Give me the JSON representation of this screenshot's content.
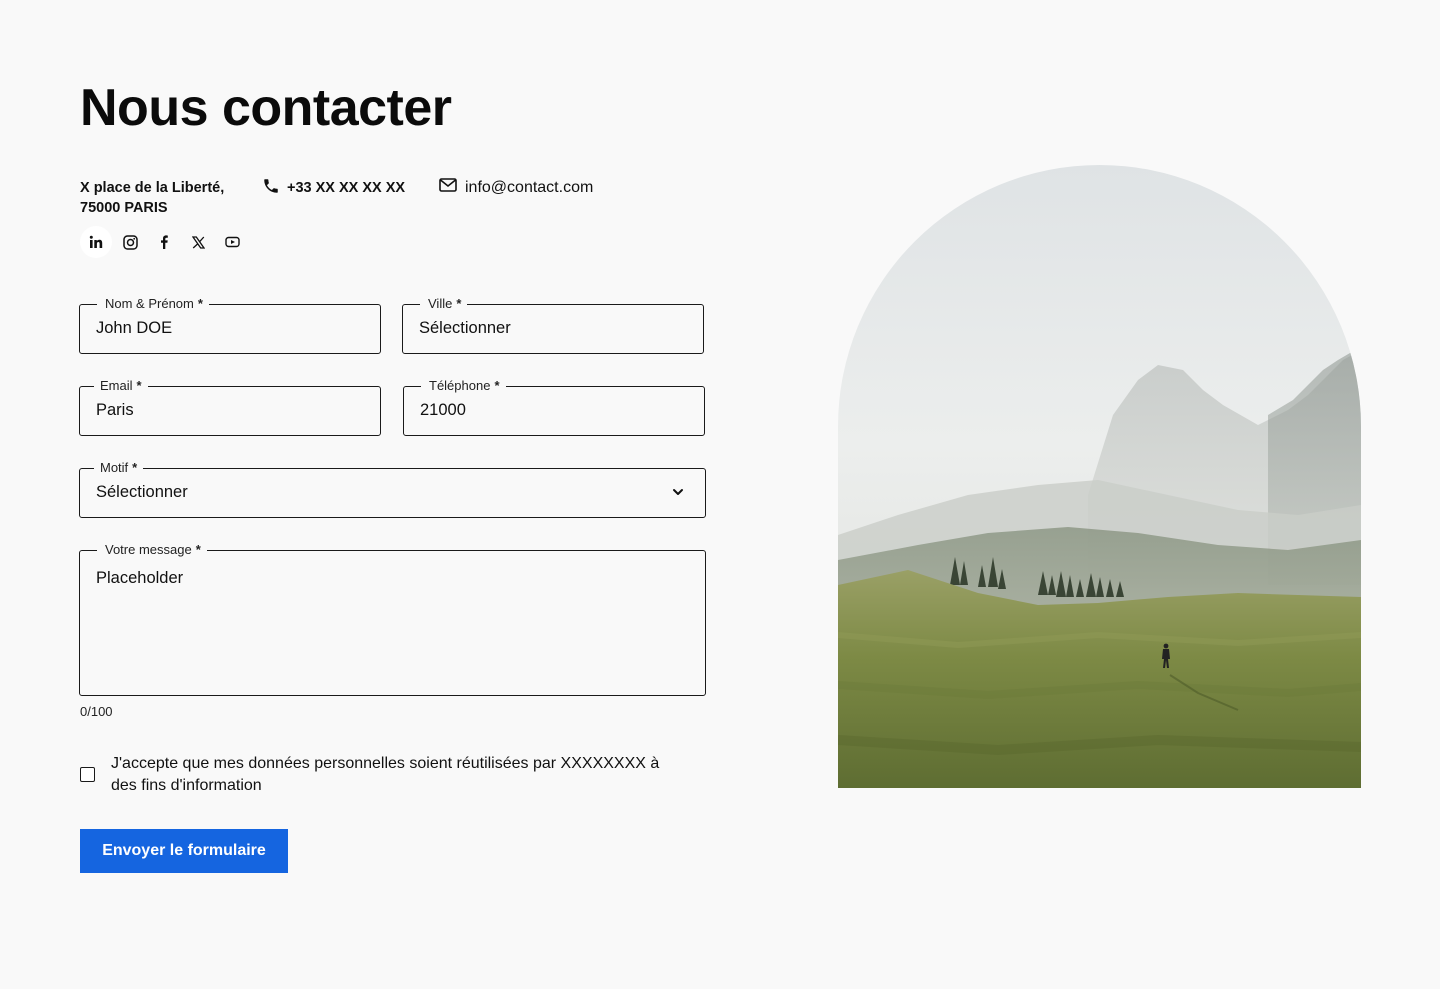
{
  "title": "Nous contacter",
  "contact": {
    "address_line1": "X place de la Liberté,",
    "address_line2": "75000 PARIS",
    "phone": "+33 XX XX XX XX",
    "email": "info@contact.com"
  },
  "socials": [
    {
      "name": "LinkedIn",
      "icon": "linkedin-icon"
    },
    {
      "name": "Instagram",
      "icon": "instagram-icon"
    },
    {
      "name": "Facebook",
      "icon": "facebook-icon"
    },
    {
      "name": "X",
      "icon": "x-icon"
    },
    {
      "name": "YouTube",
      "icon": "youtube-icon"
    }
  ],
  "form": {
    "nom": {
      "label": "Nom & Prénom",
      "value": "John DOE"
    },
    "ville": {
      "label": "Ville",
      "value": "Sélectionner"
    },
    "email": {
      "label": "Email",
      "value": "Paris"
    },
    "telephone": {
      "label": "Téléphone",
      "value": "21000"
    },
    "motif": {
      "label": "Motif",
      "value": "Sélectionner"
    },
    "message": {
      "label": "Votre message",
      "placeholder": "Placeholder",
      "counter": "0/100"
    },
    "required_mark": "*",
    "consent": "J'accepte que mes données personnelles soient réutilisées par XXXXXXXX à des fins d'information",
    "submit": "Envoyer le formulaire"
  },
  "colors": {
    "accent": "#1565e0",
    "background": "#f9f9f9",
    "text": "#111111"
  }
}
